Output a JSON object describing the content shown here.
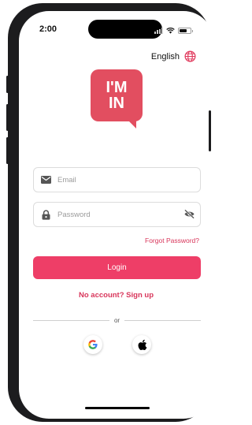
{
  "status": {
    "time": "2:00"
  },
  "language": {
    "label": "English",
    "icon": "globe-icon"
  },
  "logo": {
    "line1": "I'M",
    "line2": "IN"
  },
  "form": {
    "email_placeholder": "Email",
    "password_placeholder": "Password",
    "forgot_label": "Forgot Password?",
    "login_label": "Login",
    "signup_label": "No account? Sign up",
    "divider_label": "or"
  },
  "social": [
    {
      "name": "google",
      "icon": "google-icon"
    },
    {
      "name": "apple",
      "icon": "apple-icon"
    }
  ],
  "colors": {
    "brand": "#e24e60",
    "accent": "#ee3e67",
    "link": "#d8355a"
  }
}
